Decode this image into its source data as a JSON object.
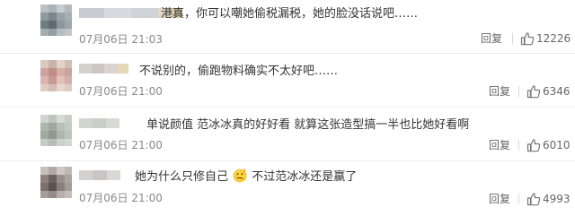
{
  "comments": [
    {
      "text": "港真，你可以嘲她偷税漏税，她的脸没话说吧……",
      "time": "07月06日 21:03",
      "reply_label": "回复",
      "likes": "12226",
      "name_colors": [
        "#c8ccd2",
        "#d7dade",
        "#cfd3d8",
        "#e0d8c4",
        "#d8c6a4"
      ]
    },
    {
      "text": "不说别的，偷跑物料确实不太好吧……",
      "time": "07月06日 21:00",
      "reply_label": "回复",
      "likes": "6346",
      "name_colors": [
        "#d4d1cd",
        "#ccc6c2",
        "#d9d4cf",
        "#e4d8b8"
      ]
    },
    {
      "text": "单说颜值  范冰冰真的好好看 就算这张造型搞一半也比她好看啊",
      "time": "07月06日 21:00",
      "reply_label": "回复",
      "likes": "6010",
      "name_colors": [
        "#d1d5d0",
        "#c9cec8",
        "#d6d9d4"
      ]
    },
    {
      "text_before": "她为什么只修自己",
      "emoji": "thinking-face-emoji",
      "text_after": "不过范冰冰还是赢了",
      "time": "07月06日 21:00",
      "reply_label": "回复",
      "likes": "4993",
      "name_colors": [
        "#d3d0cf",
        "#c8c6c5",
        "#dbd7d3"
      ]
    }
  ],
  "colors": {
    "text": "#333333",
    "meta": "#888888",
    "action": "#666666",
    "divider": "#eeeeee"
  },
  "icons": {
    "like": "thumbs-up-icon",
    "emoji": "thinking-face-emoji"
  }
}
